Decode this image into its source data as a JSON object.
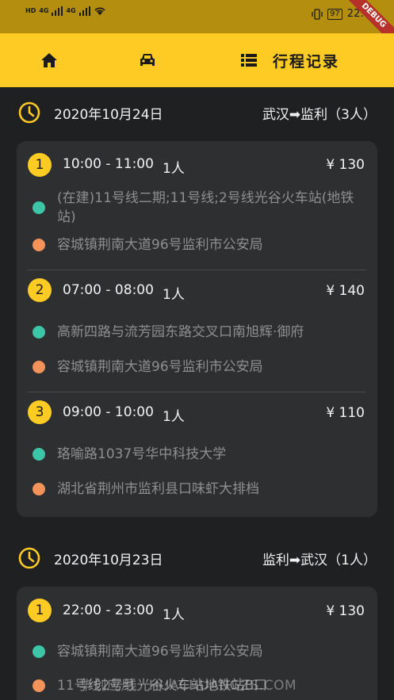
{
  "status_bar": {
    "left_labels": [
      "HD",
      "4G",
      "4G"
    ],
    "battery": "97",
    "time": "22:0",
    "debug_label": "DEBUG"
  },
  "navbar": {
    "home_icon": "home-icon",
    "car_icon": "car-icon",
    "list_icon": "list-icon",
    "title": "行程记录",
    "accent": "#fdcb23"
  },
  "days": [
    {
      "date": "2020年10月24日",
      "route": "武汉➡监利（3人）",
      "trips": [
        {
          "num": "1",
          "time": "10:00 - 11:00",
          "people": "1人",
          "price": "¥ 130",
          "from": "(在建)11号线二期;11号线;2号线光谷火车站(地铁站)",
          "to": "容城镇荆南大道96号监利市公安局"
        },
        {
          "num": "2",
          "time": "07:00 - 08:00",
          "people": "1人",
          "price": "¥ 140",
          "from": "高新四路与流芳园东路交叉口南旭辉·御府",
          "to": "容城镇荆南大道96号监利市公安局"
        },
        {
          "num": "3",
          "time": "09:00 - 10:00",
          "people": "1人",
          "price": "¥ 110",
          "from": "珞喻路1037号华中科技大学",
          "to": "湖北省荆州市监利县口味虾大排档"
        }
      ]
    },
    {
      "date": "2020年10月23日",
      "route": "监利➡武汉（1人）",
      "trips": [
        {
          "num": "1",
          "time": "22:00 - 23:00",
          "people": "1人",
          "price": "¥ 130",
          "from": "容城镇荆南大道96号监利市公安局",
          "to": "11号线2号线光谷火车站地铁站B口"
        }
      ]
    }
  ],
  "watermark": "华创应用 · HUACHUANGZS.COM"
}
